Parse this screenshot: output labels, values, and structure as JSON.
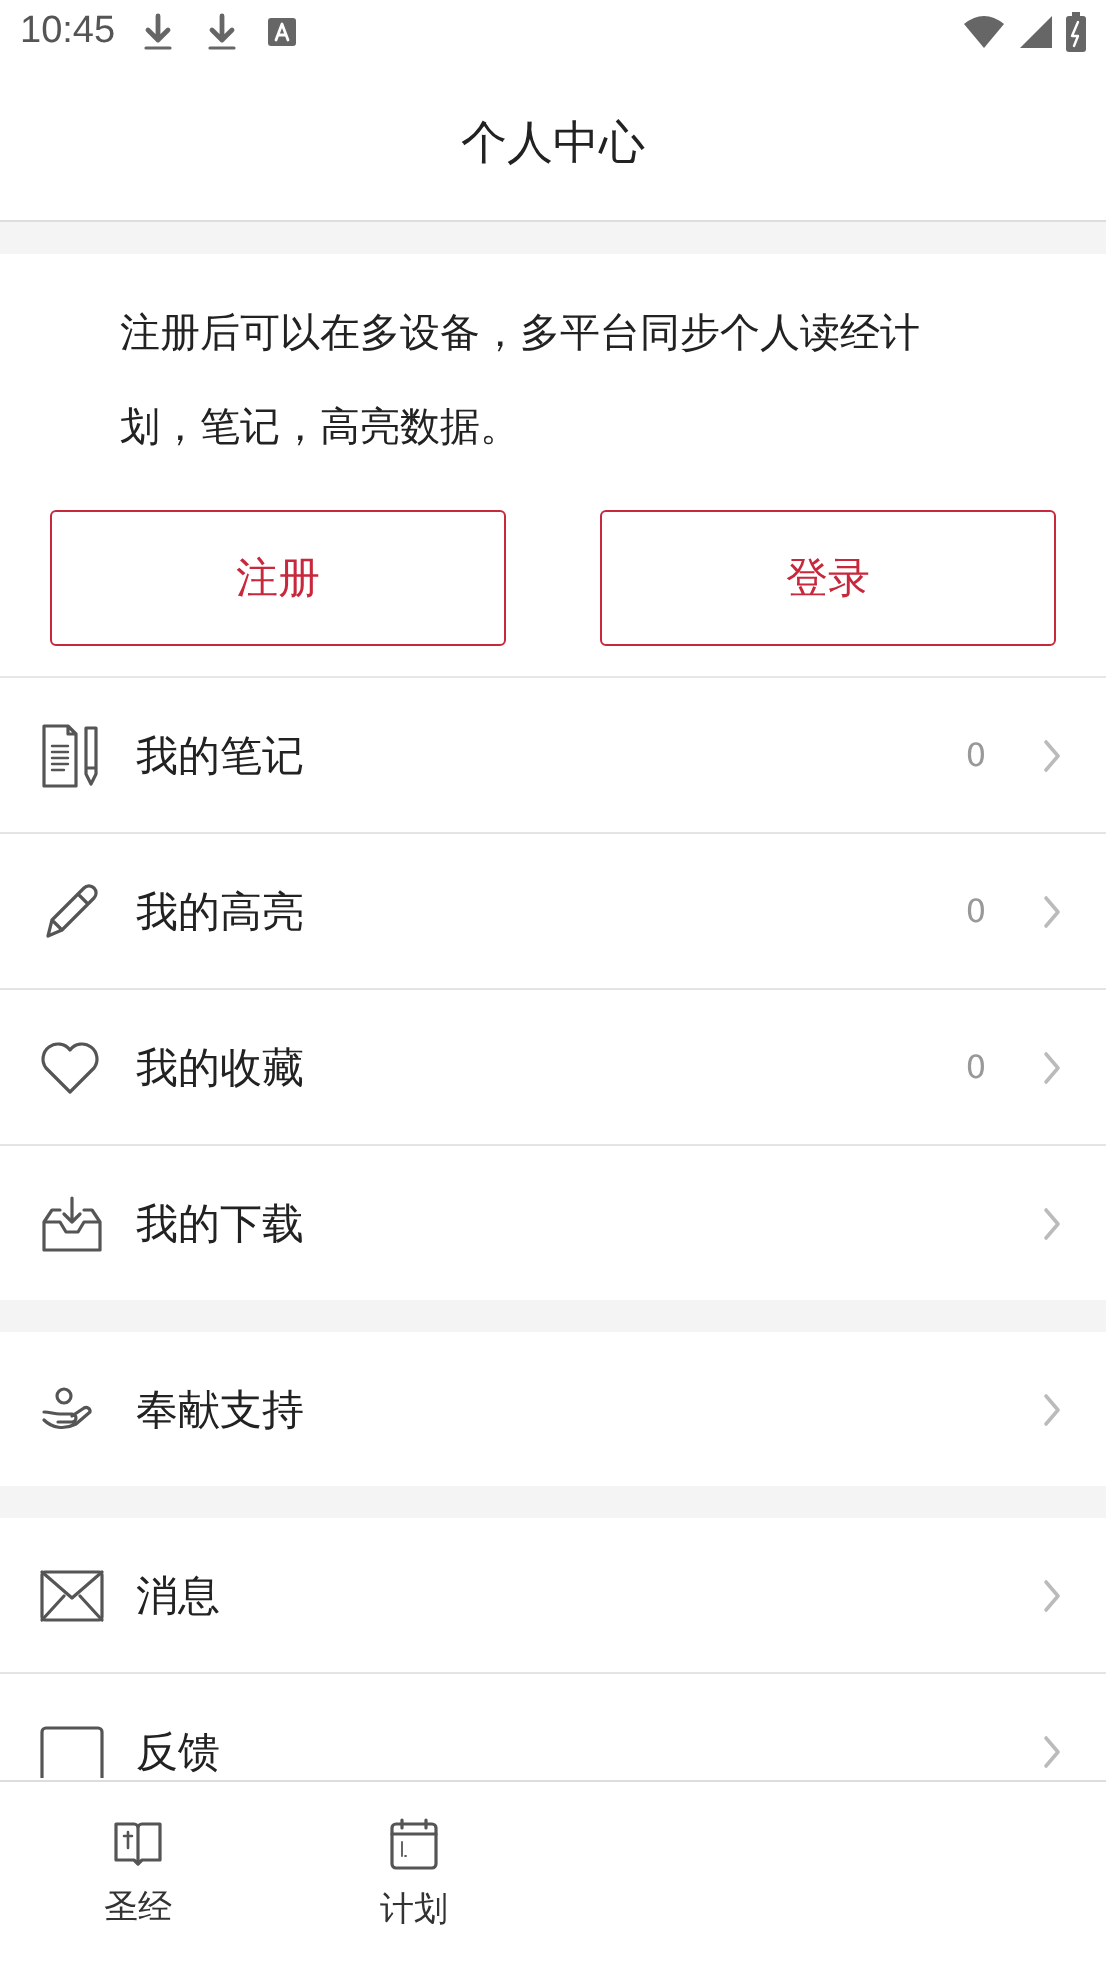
{
  "status_bar": {
    "time": "10:45"
  },
  "header": {
    "title": "个人中心"
  },
  "intro": {
    "text": "注册后可以在多设备，多平台同步个人读经计划，笔记，高亮数据。",
    "buttons": [
      "注册",
      "登录"
    ]
  },
  "groups": [
    {
      "items": [
        {
          "label": "我的笔记",
          "count": "0"
        },
        {
          "label": "我的高亮",
          "count": "0"
        },
        {
          "label": "我的收藏",
          "count": "0"
        },
        {
          "label": "我的下载"
        }
      ]
    },
    {
      "items": [
        {
          "label": "奉献支持"
        }
      ]
    },
    {
      "items": [
        {
          "label": "消息"
        },
        {
          "label": "反馈"
        }
      ]
    }
  ],
  "tabs": [
    {
      "label": "圣经"
    },
    {
      "label": "计划"
    }
  ]
}
